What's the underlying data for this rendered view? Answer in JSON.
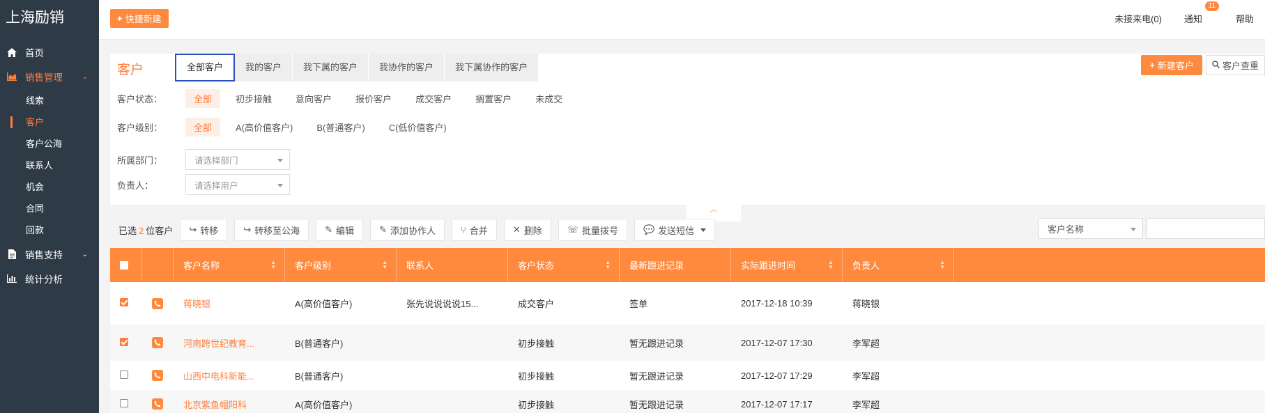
{
  "sidebar": {
    "brand": "上海励销",
    "nav": {
      "home": "首页",
      "sales_mgmt": "销售管理",
      "sales_support": "销售支持",
      "analytics": "统计分析"
    },
    "sub_items": [
      "线索",
      "客户",
      "客户公海",
      "联系人",
      "机会",
      "合同",
      "回款"
    ]
  },
  "topbar": {
    "quick_new": "快捷新建",
    "missed_calls": "未接来电(0)",
    "notify": "通知",
    "notify_badge": "11",
    "help": "帮助"
  },
  "panel": {
    "title": "客户",
    "tabs": [
      "全部客户",
      "我的客户",
      "我下属的客户",
      "我协作的客户",
      "我下属协作的客户"
    ],
    "new_customer": "新建客户",
    "dup_check": "客户查重",
    "filters": {
      "status_label": "客户状态：",
      "status_options": [
        "全部",
        "初步接触",
        "意向客户",
        "报价客户",
        "成交客户",
        "搁置客户",
        "未成交"
      ],
      "level_label": "客户级别：",
      "level_options": [
        "全部",
        "A(高价值客户)",
        "B(普通客户)",
        "C(低价值客户)"
      ],
      "dept_label": "所属部门：",
      "dept_placeholder": "请选择部门",
      "owner_label": "负责人：",
      "owner_placeholder": "请选择用户"
    }
  },
  "toolbar": {
    "selected_prefix": "已选",
    "selected_count": "2",
    "selected_suffix": "位客户",
    "buttons": [
      "转移",
      "转移至公海",
      "编辑",
      "添加协作人",
      "合并",
      "删除",
      "批量拨号",
      "发送短信"
    ],
    "search_field": "客户名称"
  },
  "table": {
    "headers": [
      "客户名称",
      "客户级别",
      "联系人",
      "客户状态",
      "最新跟进记录",
      "实际跟进时间",
      "负责人"
    ],
    "rows": [
      {
        "checked": true,
        "name": "蒋晓银",
        "level": "A(高价值客户)",
        "contact": "张先说说说说15...",
        "status": "成交客户",
        "latest": "签单",
        "time": "2017-12-18 10:39",
        "owner": "蒋晓银"
      },
      {
        "checked": true,
        "name": "河南跨世纪教育...",
        "level": "B(普通客户)",
        "contact": "",
        "status": "初步接触",
        "latest": "暂无跟进记录",
        "time": "2017-12-07 17:30",
        "owner": "李军超"
      },
      {
        "checked": false,
        "name": "山西中电科新能...",
        "level": "B(普通客户)",
        "contact": "",
        "status": "初步接触",
        "latest": "暂无跟进记录",
        "time": "2017-12-07 17:29",
        "owner": "李军超"
      },
      {
        "checked": false,
        "name": "北京紫鱼帽阳科",
        "level": "A(高价值客户)",
        "contact": "",
        "status": "初步接触",
        "latest": "暂无跟进记录",
        "time": "2017-12-07 17:17",
        "owner": "李军超"
      }
    ]
  },
  "colors": {
    "accent": "#ff8a3d",
    "sidebar_bg": "#2f3a47",
    "active_tab_border": "#2b4fbf"
  }
}
